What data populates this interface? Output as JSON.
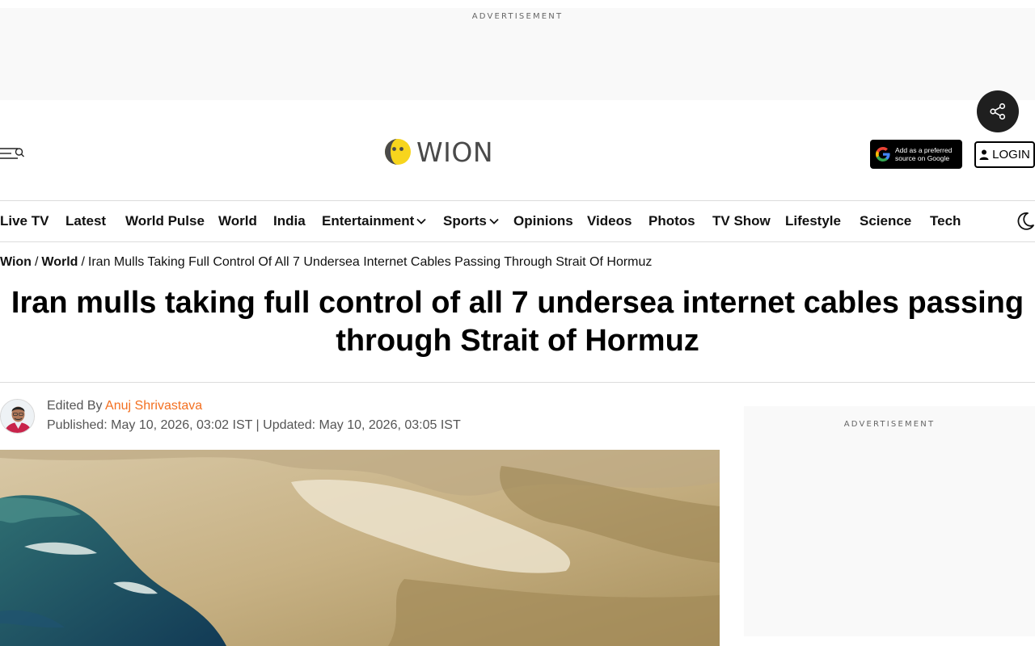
{
  "ads": {
    "top_label": "ADVERTISEMENT",
    "side_label": "ADVERTISEMENT"
  },
  "header": {
    "logo_text": "WION",
    "google_source_line1": "Add as a preferred",
    "google_source_line2": "source on Google",
    "login_label": "LOGIN"
  },
  "nav": {
    "items": [
      {
        "label": "Live TV"
      },
      {
        "label": "Latest"
      },
      {
        "label": "World Pulse"
      },
      {
        "label": "World"
      },
      {
        "label": "India"
      },
      {
        "label": "Entertainment",
        "dropdown": true
      },
      {
        "label": "Sports",
        "dropdown": true
      },
      {
        "label": "Opinions"
      },
      {
        "label": "Videos"
      },
      {
        "label": "Photos"
      },
      {
        "label": "TV Show"
      },
      {
        "label": "Lifestyle"
      },
      {
        "label": "Science"
      },
      {
        "label": "Tech"
      }
    ]
  },
  "breadcrumb": {
    "home": "Wion",
    "section": "World",
    "separator": "/",
    "current": "Iran Mulls Taking Full Control Of All 7 Undersea Internet Cables Passing Through Strait Of Hormuz"
  },
  "article": {
    "headline": "Iran mulls taking full control of all 7 undersea internet cables passing through Strait of Hormuz",
    "edited_prefix": "Edited By",
    "author": "Anuj Shrivastava",
    "dates": "Published: May 10, 2026, 03:02 IST | Updated: May 10, 2026, 03:05 IST"
  },
  "icons": {
    "share": "share-icon",
    "menu": "hamburger-menu-icon",
    "search": "search-icon",
    "google": "google-g-icon",
    "user": "user-icon",
    "theme": "moon-icon",
    "chevron": "chevron-down-icon"
  },
  "colors": {
    "accent": "#f37021",
    "logo_yellow": "#f7d51d",
    "fab": "#1f1f1f"
  }
}
